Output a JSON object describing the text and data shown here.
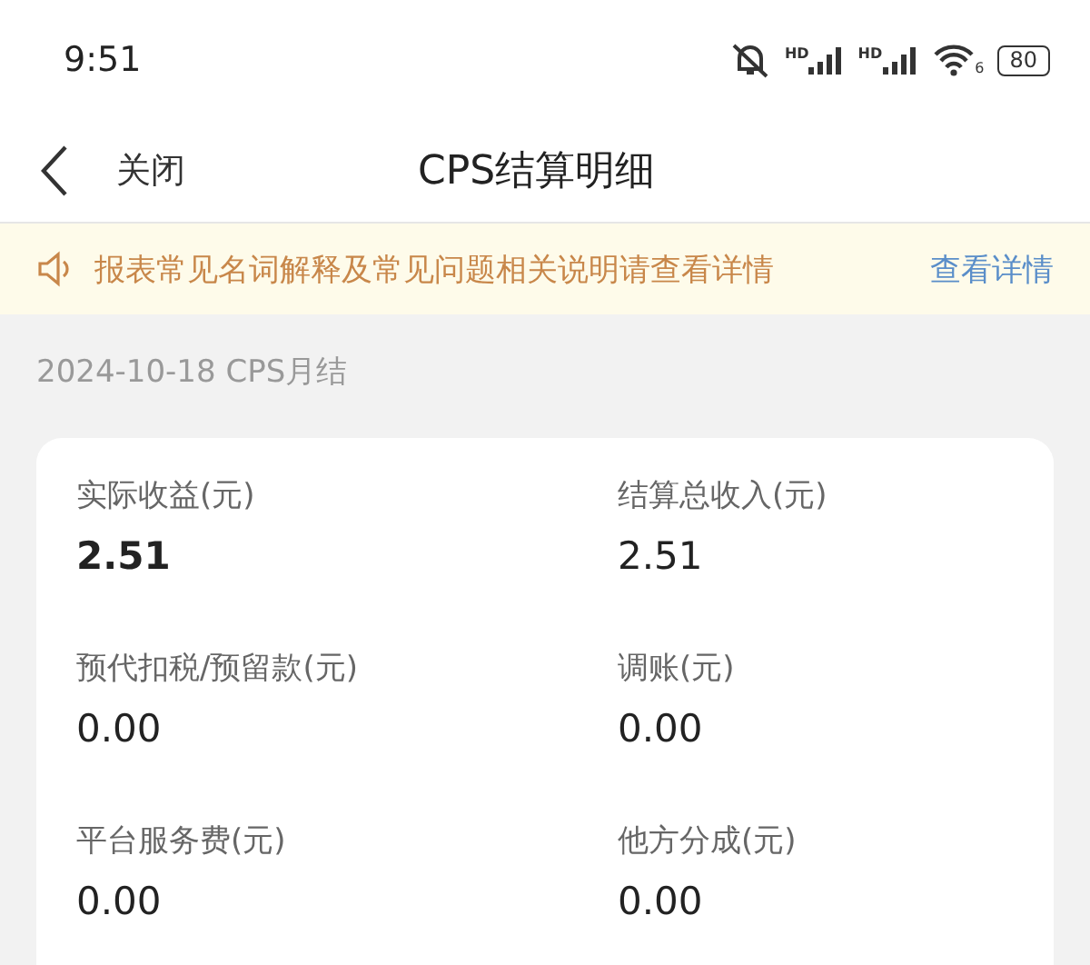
{
  "status_bar": {
    "time": "9:51",
    "signals": [
      {
        "label": "HD"
      },
      {
        "label": "HD"
      }
    ],
    "wifi_label": "6",
    "battery": "80"
  },
  "nav": {
    "back": "关闭",
    "title": "CPS结算明细"
  },
  "notice": {
    "text": "报表常见名词解释及常见问题相关说明请查看详情",
    "link": "查看详情"
  },
  "section_title": "2024-10-18 CPS月结",
  "metrics": [
    {
      "label": "实际收益(元)",
      "value": "2.51",
      "bold": true
    },
    {
      "label": "结算总收入(元)",
      "value": "2.51",
      "bold": false
    },
    {
      "label": "预代扣税/预留款(元)",
      "value": "0.00",
      "bold": false
    },
    {
      "label": "调账(元)",
      "value": "0.00",
      "bold": false
    },
    {
      "label": "平台服务费(元)",
      "value": "0.00",
      "bold": false
    },
    {
      "label": "他方分成(元)",
      "value": "0.00",
      "bold": false
    }
  ]
}
